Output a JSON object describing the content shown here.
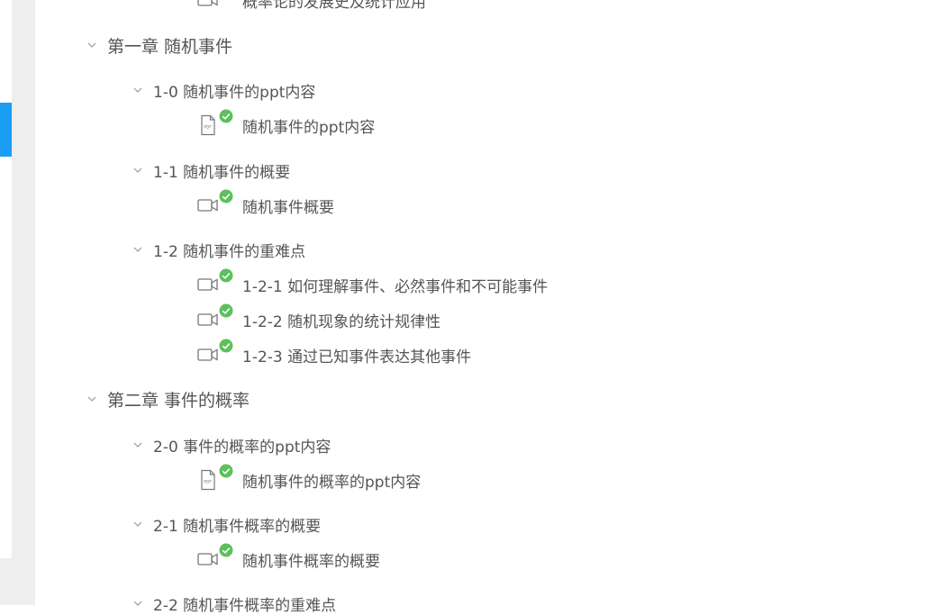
{
  "outline": {
    "cut_top_item": "概率论的发展史及统计应用",
    "chapters": [
      {
        "title": "第一章 随机事件",
        "sections": [
          {
            "title": "1-0 随机事件的ppt内容",
            "items": [
              {
                "icon": "pdf-icon",
                "label": "随机事件的ppt内容",
                "done": true
              }
            ]
          },
          {
            "title": "1-1 随机事件的概要",
            "items": [
              {
                "icon": "video-icon",
                "label": "随机事件概要",
                "done": true
              }
            ]
          },
          {
            "title": "1-2 随机事件的重难点",
            "items": [
              {
                "icon": "video-icon",
                "label": "1-2-1 如何理解事件、必然事件和不可能事件",
                "done": true
              },
              {
                "icon": "video-icon",
                "label": "1-2-2 随机现象的统计规律性",
                "done": true
              },
              {
                "icon": "video-icon",
                "label": "1-2-3 通过已知事件表达其他事件",
                "done": true
              }
            ]
          }
        ]
      },
      {
        "title": "第二章 事件的概率",
        "sections": [
          {
            "title": "2-0 事件的概率的ppt内容",
            "items": [
              {
                "icon": "pdf-icon",
                "label": "随机事件的概率的ppt内容",
                "done": true
              }
            ]
          },
          {
            "title": "2-1 随机事件概率的概要",
            "items": [
              {
                "icon": "video-icon",
                "label": "随机事件概率的概要",
                "done": true
              }
            ]
          },
          {
            "title": "2-2 随机事件概率的重难点",
            "items": []
          }
        ]
      }
    ]
  },
  "colors": {
    "accent_tab": "#1a9df5",
    "check_green": "#5cc05c",
    "text": "#555555",
    "icon_stroke": "#777777"
  }
}
